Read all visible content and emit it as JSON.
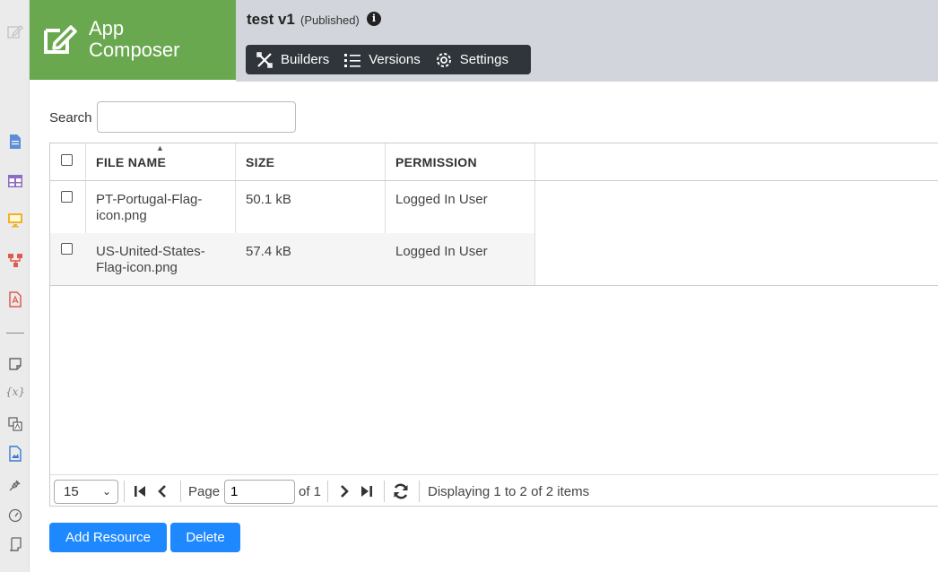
{
  "brand": {
    "line1": "App",
    "line2": "Composer"
  },
  "header": {
    "title": "test v1",
    "status": "(Published)",
    "nav": [
      "Builders",
      "Versions",
      "Settings"
    ]
  },
  "search": {
    "label": "Search",
    "value": ""
  },
  "table": {
    "columns": [
      "FILE NAME",
      "SIZE",
      "PERMISSION"
    ],
    "rows": [
      {
        "name_line1": "PT-Portugal-Flag-",
        "name_line2": "icon.png",
        "size": "50.1 kB",
        "permission": "Logged In User"
      },
      {
        "name_line1": "US-United-States-",
        "name_line2": "Flag-icon.png",
        "size": "57.4 kB",
        "permission": "Logged In User"
      }
    ]
  },
  "pager": {
    "page_size": "15",
    "page_label": "Page",
    "page_value": "1",
    "of_label": "of 1",
    "display_text": "Displaying 1 to 2 of 2 items"
  },
  "actions": {
    "add": "Add Resource",
    "delete": "Delete"
  },
  "colors": {
    "brand": "#6aa84f",
    "navbar": "#2f353b",
    "primary": "#1e88ff",
    "header": "#d2d6dc"
  }
}
